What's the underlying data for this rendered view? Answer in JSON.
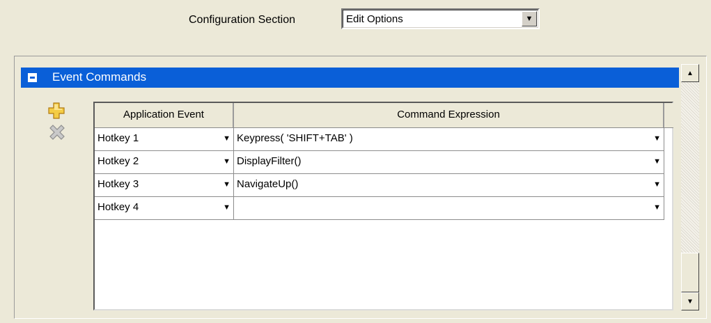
{
  "config": {
    "label": "Configuration Section",
    "selected": "Edit Options"
  },
  "section": {
    "title": "Event Commands",
    "color": "#0a5fd8"
  },
  "icons": {
    "add": "add-plus-icon",
    "remove": "remove-x-icon",
    "dropdown": "▼",
    "scroll_up": "▲",
    "scroll_down": "▼"
  },
  "grid": {
    "columns": [
      "Application Event",
      "Command Expression"
    ],
    "rows": [
      {
        "event": "Hotkey 1",
        "command": "Keypress( 'SHIFT+TAB' )"
      },
      {
        "event": "Hotkey 2",
        "command": "DisplayFilter()"
      },
      {
        "event": "Hotkey 3",
        "command": "NavigateUp()"
      },
      {
        "event": "Hotkey 4",
        "command": ""
      }
    ]
  }
}
